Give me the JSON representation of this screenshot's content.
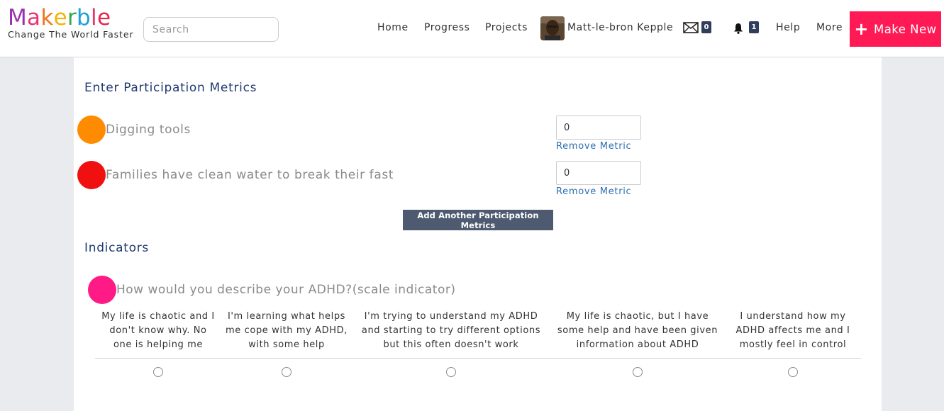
{
  "brand": {
    "letters": [
      {
        "ch": "M",
        "color": "#9b2fae"
      },
      {
        "ch": "a",
        "color": "#e9336f"
      },
      {
        "ch": "k",
        "color": "#f0741f"
      },
      {
        "ch": "e",
        "color": "#f4b400"
      },
      {
        "ch": "r",
        "color": "#36a84a"
      },
      {
        "ch": "b",
        "color": "#1ea0d8"
      },
      {
        "ch": "l",
        "color": "#e9336f"
      },
      {
        "ch": "e",
        "color": "#e0294e"
      }
    ],
    "tagline": "Change The World Faster"
  },
  "search": {
    "placeholder": "Search"
  },
  "nav": {
    "home": "Home",
    "progress": "Progress",
    "projects": "Projects",
    "user_name": "Matt-le-bron Kepple",
    "messages_count": "0",
    "notifications_count": "1",
    "help": "Help",
    "more": "More",
    "make_new": "Make New"
  },
  "participation": {
    "title": "Enter Participation Metrics",
    "metrics": [
      {
        "name": "Digging tools",
        "value": "0",
        "remove_label": "Remove Metric",
        "color": "#ff8c00"
      },
      {
        "name": "Families have clean water to break their fast",
        "value": "0",
        "remove_label": "Remove Metric",
        "color": "#f01010"
      }
    ],
    "add_button": "Add Another Participation Metrics"
  },
  "indicators": {
    "title": "Indicators",
    "question": "How would you describe your ADHD?(scale indicator)",
    "question_color": "#ff1a85",
    "scale": [
      {
        "lines": [
          "My life is chaotic and I",
          "don't know why. No",
          "one is helping me"
        ]
      },
      {
        "lines": [
          "I'm learning what helps",
          "me cope with my ADHD,",
          "with some help"
        ]
      },
      {
        "lines": [
          "I'm trying to understand my ADHD",
          "and starting to try different options",
          "but this often doesn't work"
        ]
      },
      {
        "lines": [
          "My life is chaotic, but I have",
          "some help and have been given",
          "information about ADHD"
        ]
      },
      {
        "lines": [
          "I understand how my",
          "ADHD affects me and I",
          "mostly feel in control"
        ]
      }
    ]
  },
  "colors": {
    "accent": "#ff1a55",
    "title_blue": "#1f3a6e",
    "link_blue": "#2c6fb0",
    "badge": "#2f3e5a"
  }
}
